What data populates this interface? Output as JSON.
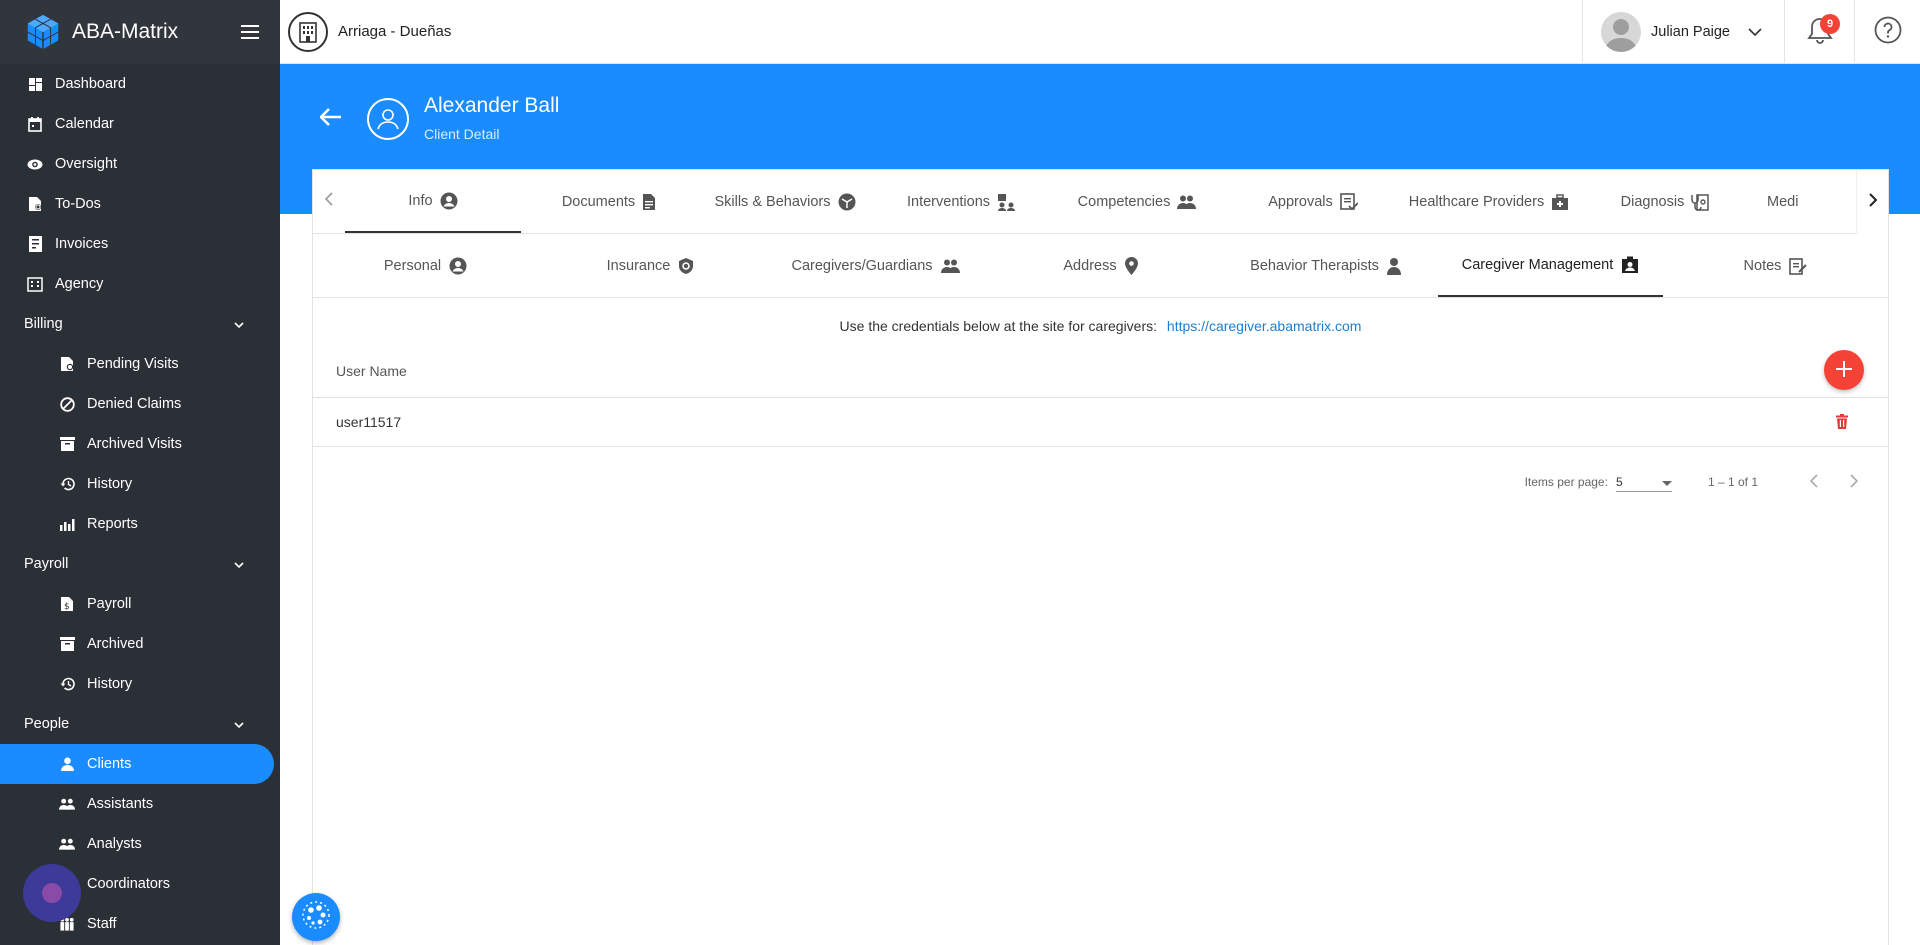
{
  "app": {
    "name": "ABA-Matrix",
    "org_name": "Arriaga - Dueñas",
    "user_name": "Julian Paige",
    "notification_count": "9",
    "brand_color": "#1a8cff",
    "sidebar_color": "#2b2f36"
  },
  "sidebar": {
    "top_items": [
      {
        "label": "Dashboard",
        "icon": "dashboard-icon"
      },
      {
        "label": "Calendar",
        "icon": "calendar-icon"
      },
      {
        "label": "Oversight",
        "icon": "eye-icon"
      },
      {
        "label": "To-Dos",
        "icon": "todo-icon"
      },
      {
        "label": "Invoices",
        "icon": "invoice-icon"
      },
      {
        "label": "Agency",
        "icon": "agency-icon"
      }
    ],
    "billing": {
      "label": "Billing",
      "items": [
        {
          "label": "Pending Visits",
          "icon": "pending-icon"
        },
        {
          "label": "Denied Claims",
          "icon": "denied-icon"
        },
        {
          "label": "Archived Visits",
          "icon": "archive-icon"
        },
        {
          "label": "History",
          "icon": "history-icon"
        },
        {
          "label": "Reports",
          "icon": "reports-icon"
        }
      ]
    },
    "payroll": {
      "label": "Payroll",
      "items": [
        {
          "label": "Payroll",
          "icon": "payroll-icon"
        },
        {
          "label": "Archived",
          "icon": "archive-icon"
        },
        {
          "label": "History",
          "icon": "history-icon"
        }
      ]
    },
    "people": {
      "label": "People",
      "items": [
        {
          "label": "Clients",
          "icon": "person-icon",
          "active": true
        },
        {
          "label": "Assistants",
          "icon": "group-icon"
        },
        {
          "label": "Analysts",
          "icon": "group-icon"
        },
        {
          "label": "Coordinators",
          "icon": "group-icon"
        },
        {
          "label": "Staff",
          "icon": "staff-icon"
        }
      ]
    }
  },
  "client": {
    "name": "Alexander Ball",
    "subtitle": "Client Detail"
  },
  "main_tabs": [
    {
      "label": "Info",
      "icon": "account-circle-icon",
      "active": true
    },
    {
      "label": "Documents",
      "icon": "document-icon"
    },
    {
      "label": "Skills & Behaviors",
      "icon": "skills-icon"
    },
    {
      "label": "Interventions",
      "icon": "interventions-icon"
    },
    {
      "label": "Competencies",
      "icon": "group-icon"
    },
    {
      "label": "Approvals",
      "icon": "approval-icon"
    },
    {
      "label": "Healthcare Providers",
      "icon": "medical-bag-icon"
    },
    {
      "label": "Diagnosis",
      "icon": "stethoscope-icon"
    },
    {
      "label": "Medi",
      "icon": ""
    }
  ],
  "sub_tabs": [
    {
      "label": "Personal",
      "icon": "account-circle-icon"
    },
    {
      "label": "Insurance",
      "icon": "shield-icon"
    },
    {
      "label": "Caregivers/Guardians",
      "icon": "group-icon"
    },
    {
      "label": "Address",
      "icon": "location-icon"
    },
    {
      "label": "Behavior Therapists",
      "icon": "person-icon"
    },
    {
      "label": "Caregiver Management",
      "icon": "account-box-icon",
      "active": true
    },
    {
      "label": "Notes",
      "icon": "notes-icon"
    }
  ],
  "caregiver": {
    "instruction": "Use the credentials below at the site for caregivers:",
    "link": "https://caregiver.abamatrix.com",
    "column_header": "User Name",
    "rows": [
      {
        "user_name": "user11517"
      }
    ]
  },
  "paginator": {
    "items_per_page_label": "Items per page:",
    "items_per_page": "5",
    "range": "1 – 1 of 1"
  }
}
